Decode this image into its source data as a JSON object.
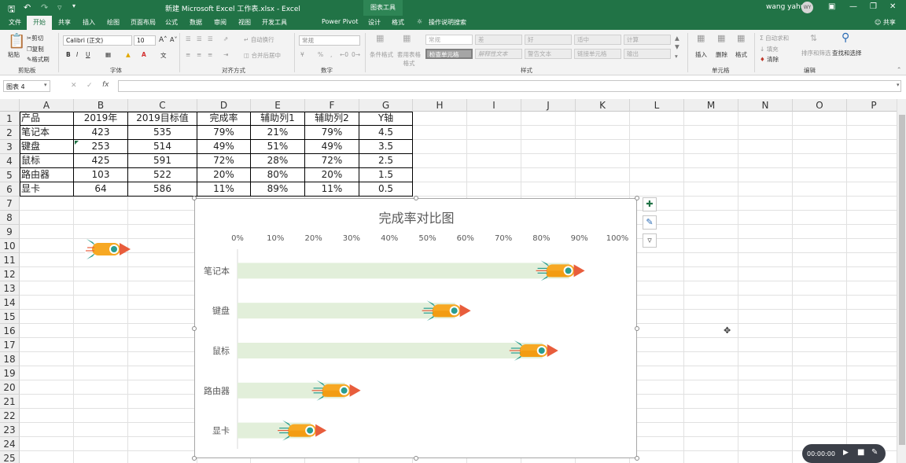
{
  "window": {
    "title": "新建 Microsoft Excel 工作表.xlsx  -  Excel",
    "context_tab": "图表工具",
    "user": "wang yahui",
    "avatar": "WY"
  },
  "tabs": [
    "文件",
    "开始",
    "共享",
    "插入",
    "绘图",
    "页面布局",
    "公式",
    "数据",
    "审阅",
    "视图",
    "开发工具",
    "Power Pivot",
    "设计",
    "格式"
  ],
  "tabs_active": "开始",
  "tell_me": "操作说明搜索",
  "share": "共享",
  "ribbon": {
    "clipboard": {
      "paste": "粘贴",
      "cut": "剪切",
      "copy": "复制",
      "format_painter": "格式刷",
      "label": "剪贴板"
    },
    "font": {
      "name": "Calibri (正文)",
      "size": "10",
      "label": "字体",
      "bold": "B",
      "italic": "I",
      "underline": "U"
    },
    "alignment": {
      "wrap": "自动换行",
      "merge": "合并后居中",
      "label": "对齐方式"
    },
    "number": {
      "format": "常规",
      "label": "数字"
    },
    "styles": {
      "conditional": "条件格式",
      "table": "套用表格格式",
      "items": [
        "常规",
        "差",
        "好",
        "适中",
        "计算",
        "检查单元格",
        "解释性文本",
        "警告文本",
        "链接单元格",
        "输出"
      ],
      "label": "样式"
    },
    "cells": {
      "insert": "插入",
      "delete": "删除",
      "format": "格式",
      "label": "单元格"
    },
    "editing": {
      "autosum": "自动求和",
      "fill": "填充",
      "clear": "清除",
      "sort": "排序和筛选",
      "find": "查找和选择",
      "label": "编辑"
    }
  },
  "formula_bar": {
    "name_box": "图表 4",
    "fx": "fx"
  },
  "columns": [
    "A",
    "B",
    "C",
    "D",
    "E",
    "F",
    "G",
    "H",
    "I",
    "J",
    "K",
    "L",
    "M",
    "N",
    "O",
    "P"
  ],
  "rows": [
    "1",
    "2",
    "3",
    "4",
    "5",
    "6",
    "7",
    "8",
    "9",
    "10",
    "11",
    "12",
    "13",
    "14",
    "15",
    "16",
    "17",
    "18",
    "19",
    "20",
    "21",
    "22",
    "23",
    "24",
    "25"
  ],
  "table": {
    "header": [
      "产品",
      "2019年",
      "2019目标值",
      "完成率",
      "辅助列1",
      "辅助列2",
      "Y轴"
    ],
    "rows": [
      [
        "笔记本",
        "423",
        "535",
        "79%",
        "21%",
        "79%",
        "4.5"
      ],
      [
        "键盘",
        "253",
        "514",
        "49%",
        "51%",
        "49%",
        "3.5"
      ],
      [
        "鼠标",
        "425",
        "591",
        "72%",
        "28%",
        "72%",
        "2.5"
      ],
      [
        "路由器",
        "103",
        "522",
        "20%",
        "80%",
        "20%",
        "1.5"
      ],
      [
        "显卡",
        "64",
        "586",
        "11%",
        "89%",
        "11%",
        "0.5"
      ]
    ]
  },
  "chart_data": {
    "type": "bar",
    "title": "完成率对比图",
    "categories": [
      "笔记本",
      "键盘",
      "鼠标",
      "路由器",
      "显卡"
    ],
    "values": [
      0.79,
      0.49,
      0.72,
      0.2,
      0.11
    ],
    "x_ticks": [
      "0%",
      "10%",
      "20%",
      "30%",
      "40%",
      "50%",
      "60%",
      "70%",
      "80%",
      "90%",
      "100%"
    ],
    "xlim": [
      0,
      1
    ],
    "track_color": "#e2efda",
    "marker": "rocket-icon"
  },
  "recorder": {
    "time": "00:00:00"
  },
  "colors": {
    "excel_green": "#217346",
    "rocket_orange": "#f7a823",
    "rocket_teal": "#2a9d8f",
    "rocket_red": "#e85d3c"
  }
}
